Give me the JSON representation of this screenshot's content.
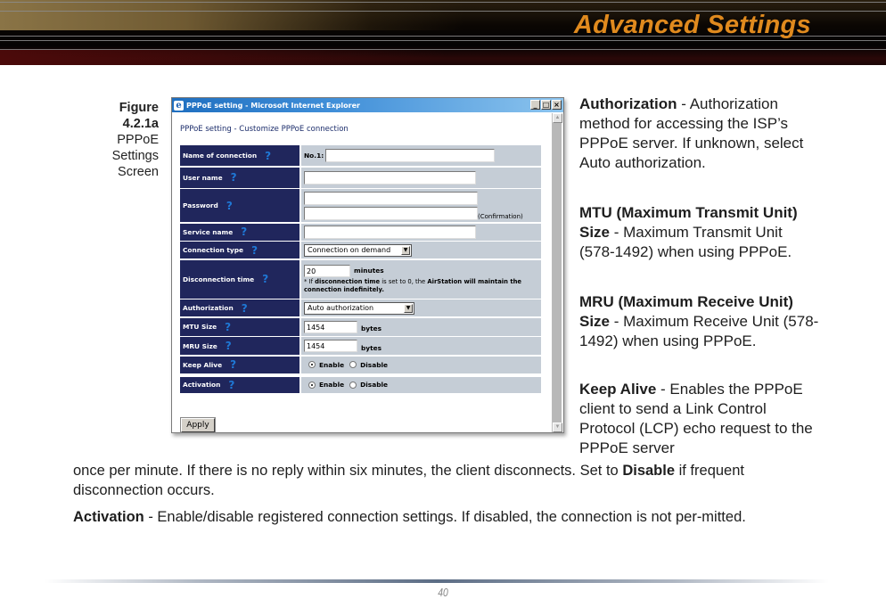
{
  "header": {
    "title": "Advanced Settings",
    "title_color": "#e08a1e"
  },
  "caption": {
    "figure": "Figure",
    "number": "4.2.1a",
    "line1": "PPPoE",
    "line2": "Settings",
    "line3": "Screen"
  },
  "window": {
    "title": "PPPoE setting - Microsoft Internet Explorer",
    "icon": "ie-icon",
    "buttons": {
      "minimize": "_",
      "maximize": "□",
      "close": "×"
    },
    "page_heading": "PPPoE setting - Customize PPPoE connection",
    "help_glyph": "?",
    "form": {
      "name_of_connection": {
        "label": "Name of connection",
        "prefix": "No.1:",
        "value": ""
      },
      "user_name": {
        "label": "User name",
        "value": ""
      },
      "password": {
        "label": "Password",
        "value": "",
        "confirmation_value": "",
        "confirmation_label": "(Confirmation)"
      },
      "service_name": {
        "label": "Service name",
        "value": ""
      },
      "connection_type": {
        "label": "Connection type",
        "selected": "Connection on demand"
      },
      "disconnection_time": {
        "label": "Disconnection time",
        "value": "20",
        "unit": "minutes",
        "note_prefix": "* If ",
        "note_bold": "disconnection time",
        "note_mid": " is set to 0, the ",
        "note_bold2": "AirStation",
        "note_rest": " will maintain the connection indefinitely."
      },
      "authorization": {
        "label": "Authorization",
        "selected": "Auto authorization"
      },
      "mtu_size": {
        "label": "MTU Size",
        "value": "1454",
        "unit": "bytes"
      },
      "mru_size": {
        "label": "MRU Size",
        "value": "1454",
        "unit": "bytes"
      },
      "keep_alive": {
        "label": "Keep Alive",
        "enable": "Enable",
        "disable": "Disable",
        "selected": "Enable"
      },
      "activation": {
        "label": "Activation",
        "enable": "Enable",
        "disable": "Disable",
        "selected": "Enable"
      }
    },
    "apply_label": "Apply"
  },
  "descriptions": {
    "authorization": {
      "term": "Authorization",
      "text": " - Authorization method for accessing the ISP’s PPPoE server.  If unknown, select Auto authorization."
    },
    "mtu": {
      "term": "MTU (Maximum Transmit Unit) Size",
      "text": " - Maximum Transmit Unit (578-1492) when using PPPoE."
    },
    "mru": {
      "term": "MRU (Maximum Receive Unit) Size",
      "text": " - Maximum Receive Unit (578-1492) when using PPPoE."
    },
    "keep_alive": {
      "term": "Keep Alive",
      "text": " - Enables the PPPoE client to send a Link Control Protocol (LCP) echo request to the PPPoE server",
      "continuation": "once per minute.  If there is no reply within six minutes, the client disconnects.  Set to ",
      "bold_word": "Disable",
      "continuation_end": " if frequent disconnection occurs."
    },
    "activation": {
      "term": "Activation",
      "text": " - Enable/disable registered connection settings. If disabled, the connection is not per-mitted."
    }
  },
  "footer": {
    "page_number": "40"
  }
}
